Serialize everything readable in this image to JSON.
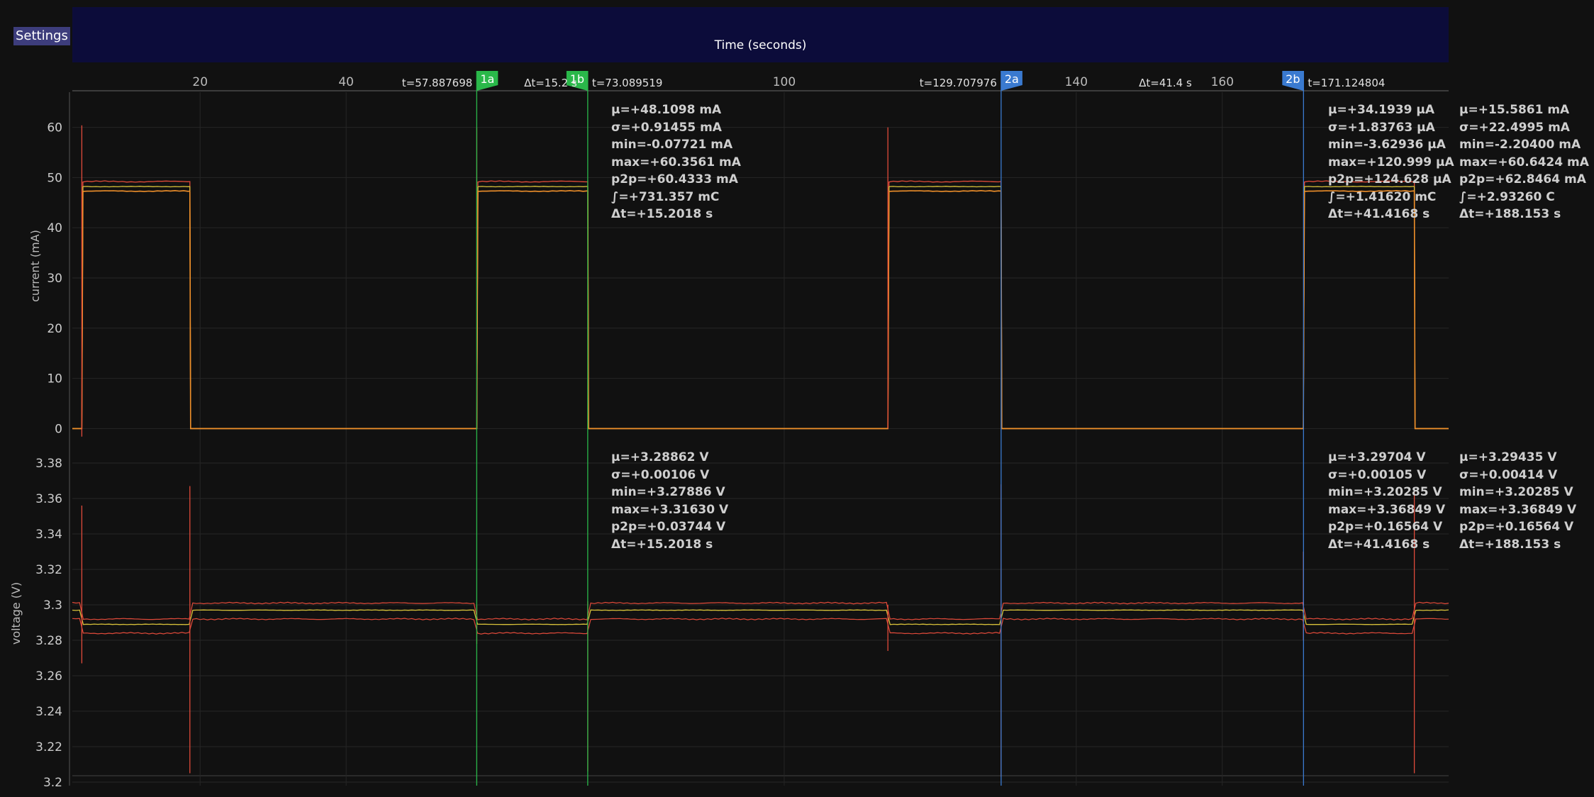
{
  "toolbar": {
    "settings_label": "Settings"
  },
  "header": {
    "title": "Time (seconds)"
  },
  "colors": {
    "background": "#111111",
    "header": "#0c0c3a",
    "series_max": "#e04a3a",
    "series_mean": "#d8c23a",
    "series_min": "#f0902a",
    "marker_1": "#2ab84a",
    "marker_2": "#3a7ad0"
  },
  "chart_data": {
    "type": "line",
    "x": {
      "label": "Time (seconds)",
      "range": [
        2.5,
        191
      ],
      "ticks": [
        20,
        40,
        100,
        140,
        160
      ]
    },
    "current": {
      "ylabel": "current (mA)",
      "ylim": [
        -2.2,
        67
      ],
      "ticks": [
        0,
        10,
        20,
        30,
        40,
        50,
        60
      ],
      "levels": {
        "max": 49.2,
        "mean": 48.2,
        "min": 47.3
      },
      "pulses": [
        [
          3.8,
          18.6
        ],
        [
          57.9,
          73.1
        ],
        [
          114.2,
          129.7
        ],
        [
          171.1,
          186.3
        ]
      ],
      "spikes": [
        {
          "x": 3.8,
          "hi": 60.4,
          "lo": -1.6
        },
        {
          "x": 57.9,
          "hi": 60.0,
          "lo": 0
        },
        {
          "x": 114.2,
          "hi": 60.0,
          "lo": 0
        }
      ]
    },
    "voltage": {
      "ylabel": "voltage (V)",
      "ylim": [
        3.198,
        3.39
      ],
      "ticks": [
        3.2,
        3.22,
        3.24,
        3.26,
        3.28,
        3.3,
        3.32,
        3.34,
        3.36,
        3.38
      ],
      "tick_labels": [
        "3.2",
        "3.22",
        "3.24",
        "3.26",
        "3.28",
        "3.3",
        "3.32",
        "3.34",
        "3.36",
        "3.38"
      ],
      "on": {
        "max": 3.292,
        "mean": 3.289,
        "min": 3.284
      },
      "off": {
        "max": 3.301,
        "mean": 3.297,
        "min": 3.292
      },
      "spikes": [
        {
          "x": 3.8,
          "hi": 3.356,
          "lo": 3.267
        },
        {
          "x": 18.6,
          "hi": 3.367,
          "lo": 3.205
        },
        {
          "x": 57.9,
          "hi": 3.3,
          "lo": 3.278
        },
        {
          "x": 73.1,
          "hi": 3.302,
          "lo": 3.206
        },
        {
          "x": 114.2,
          "hi": 3.3,
          "lo": 3.274
        },
        {
          "x": 129.7,
          "hi": 3.368,
          "lo": 3.203
        },
        {
          "x": 171.1,
          "hi": 3.33,
          "lo": 3.28
        },
        {
          "x": 186.3,
          "hi": 3.364,
          "lo": 3.205
        }
      ]
    }
  },
  "markers": [
    {
      "id": "1a",
      "x": 57.887698,
      "t_label": "t=57.887698",
      "color": "#2ab84a"
    },
    {
      "id": "1b",
      "x": 73.089519,
      "t_label": "t=73.089519",
      "color": "#2ab84a"
    },
    {
      "id": "2a",
      "x": 129.707976,
      "t_label": "t=129.707976",
      "color": "#3a7ad0"
    },
    {
      "id": "2b",
      "x": 171.124804,
      "t_label": "t=171.124804",
      "color": "#3a7ad0"
    }
  ],
  "dt_labels": [
    {
      "x": 68,
      "text": "Δt=15.2 s"
    },
    {
      "x": 152.2,
      "text": "Δt=41.4 s"
    }
  ],
  "stats": {
    "m1_current": [
      "μ=+48.1098 mA",
      "σ=+0.91455 mA",
      "min=-0.07721 mA",
      "max=+60.3561 mA",
      "p2p=+60.4333 mA",
      "∫=+731.357 mC",
      "Δt=+15.2018 s"
    ],
    "m2_current": [
      "μ=+34.1939 μA",
      "σ=+1.83763 μA",
      "min=-3.62936 μA",
      "max=+120.999 μA",
      "p2p=+124.628 μA",
      "∫=+1.41620 mC",
      "Δt=+41.4168 s"
    ],
    "all_current": [
      "μ=+15.5861 mA",
      "σ=+22.4995 mA",
      "min=-2.20400 mA",
      "max=+60.6424 mA",
      "p2p=+62.8464 mA",
      "∫=+2.93260 C",
      "Δt=+188.153 s"
    ],
    "m1_voltage": [
      "μ=+3.28862 V",
      "σ=+0.00106 V",
      "min=+3.27886 V",
      "max=+3.31630 V",
      "p2p=+0.03744 V",
      "Δt=+15.2018 s"
    ],
    "m2_voltage": [
      "μ=+3.29704 V",
      "σ=+0.00105 V",
      "min=+3.20285 V",
      "max=+3.36849 V",
      "p2p=+0.16564 V",
      "Δt=+41.4168 s"
    ],
    "all_voltage": [
      "μ=+3.29435 V",
      "σ=+0.00414 V",
      "min=+3.20285 V",
      "max=+3.36849 V",
      "p2p=+0.16564 V",
      "Δt=+188.153 s"
    ]
  }
}
